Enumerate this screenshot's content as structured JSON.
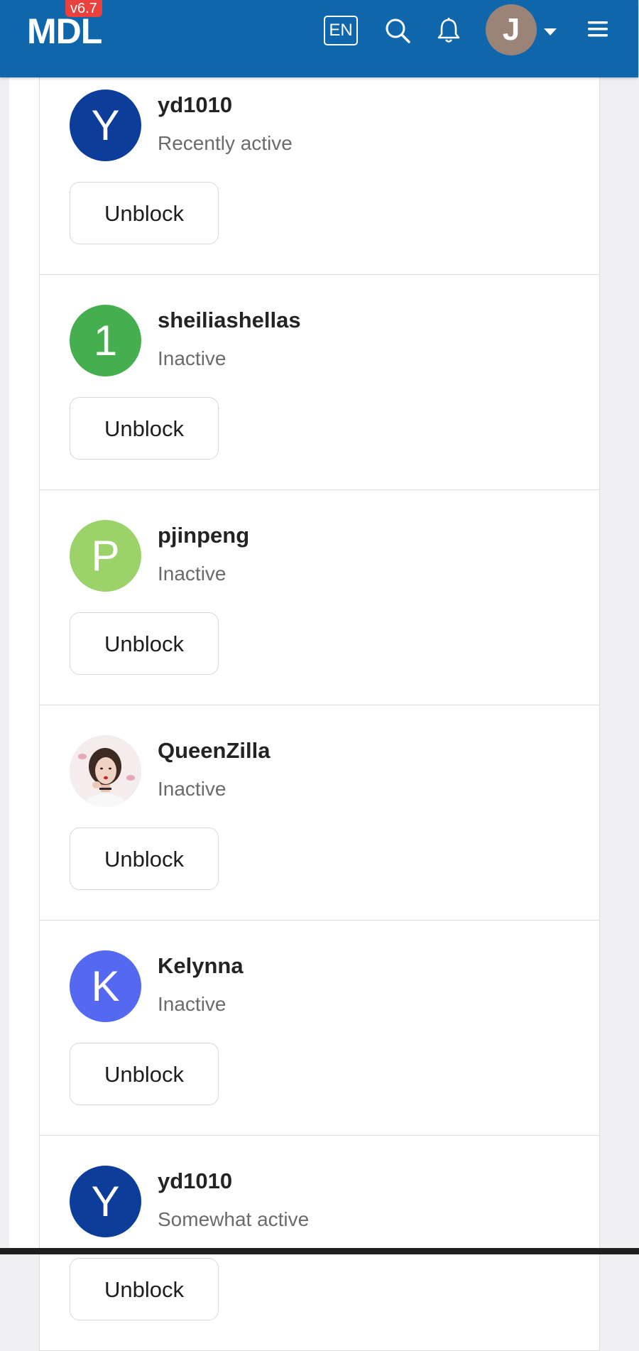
{
  "header": {
    "logo": "MDL",
    "version": "v6.7",
    "language": "EN",
    "user_initial": "J",
    "icons": [
      "search-icon",
      "bell-icon",
      "caret-down-icon",
      "hamburger-menu-icon"
    ]
  },
  "colors": {
    "navbar": "#0f66aa",
    "version_badge": "#e8413e",
    "user_avatar": "#9c8377"
  },
  "blocked_users": [
    {
      "initial": "Y",
      "name": "yd1010",
      "status": "Recently active",
      "avatar_color": "#0d3d9a",
      "button": "Unblock"
    },
    {
      "initial": "1",
      "name": "sheiliashellas",
      "status": "Inactive",
      "avatar_color": "#45ae4f",
      "button": "Unblock"
    },
    {
      "initial": "P",
      "name": "pjinpeng",
      "status": "Inactive",
      "avatar_color": "#9bd36a",
      "button": "Unblock"
    },
    {
      "initial": "",
      "name": "QueenZilla",
      "status": "Inactive",
      "avatar_color": "#f3e9ea",
      "button": "Unblock"
    },
    {
      "initial": "K",
      "name": "Kelynna",
      "status": "Inactive",
      "avatar_color": "#5468f0",
      "button": "Unblock"
    },
    {
      "initial": "Y",
      "name": "yd1010",
      "status": "Somewhat active",
      "avatar_color": "#0d3d9a",
      "button": "Unblock"
    }
  ]
}
